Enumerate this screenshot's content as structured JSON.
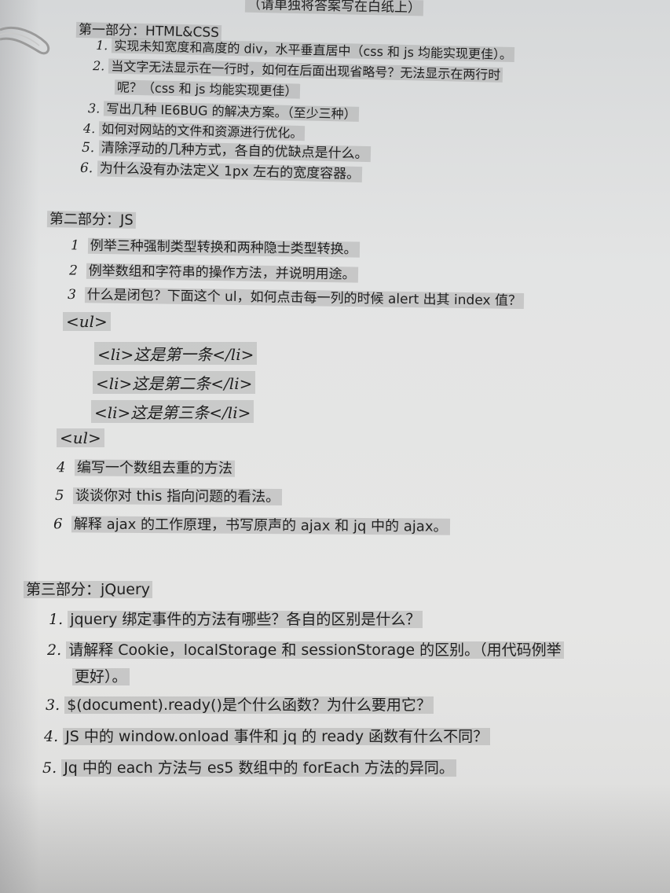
{
  "top_note": "（请单独将答案写在白纸上）",
  "sections": [
    {
      "title": "第一部分：HTML&CSS",
      "items": [
        {
          "num": "1.",
          "text": "实现未知宽度和高度的 div，水平垂直居中（css 和 js 均能实现更佳）。"
        },
        {
          "num": "2.",
          "text": "当文字无法显示在一行时，如何在后面出现省略号？无法显示在两行时"
        },
        {
          "num": "",
          "text": "呢？（css 和 js 均能实现更佳）"
        },
        {
          "num": "3.",
          "text": "写出几种 IE6BUG 的解决方案。（至少三种）"
        },
        {
          "num": "4.",
          "text": "如何对网站的文件和资源进行优化。"
        },
        {
          "num": "5.",
          "text": "清除浮动的几种方式，各自的优缺点是什么。"
        },
        {
          "num": "6.",
          "text": "为什么没有办法定义 1px 左右的宽度容器。"
        }
      ]
    },
    {
      "title": "第二部分：JS",
      "items": [
        {
          "num": "1",
          "text": "例举三种强制类型转换和两种隐士类型转换。"
        },
        {
          "num": "2",
          "text": "例举数组和字符串的操作方法，并说明用途。"
        },
        {
          "num": "3",
          "text": "什么是闭包？下面这个 ul，如何点击每一列的时候 alert 出其 index 值？"
        },
        {
          "num": "4",
          "text": "编写一个数组去重的方法"
        },
        {
          "num": "5",
          "text": "谈谈你对 this 指向问题的看法。"
        },
        {
          "num": "6",
          "text": "解释 ajax 的工作原理，书写原声的 ajax 和 jq 中的 ajax。"
        }
      ],
      "code": [
        "<ul>",
        "<li>这是第一条</li>",
        "<li>这是第二条</li>",
        "<li>这是第三条</li>",
        "<ul>"
      ]
    },
    {
      "title": "第三部分：jQuery",
      "items": [
        {
          "num": "1.",
          "text": "jquery 绑定事件的方法有哪些？各自的区别是什么？"
        },
        {
          "num": "2.",
          "text": "请解释 Cookie，localStorage 和 sessionStorage 的区别。（用代码例举"
        },
        {
          "num": "",
          "text": "更好）。"
        },
        {
          "num": "3.",
          "text": "$(document).ready()是个什么函数？为什么要用它？"
        },
        {
          "num": "4.",
          "text": "JS 中的 window.onload 事件和 jq 的 ready 函数有什么不同？"
        },
        {
          "num": "5.",
          "text": "Jq 中的 each 方法与 es5 数组中的 forEach 方法的异同。"
        }
      ]
    }
  ]
}
